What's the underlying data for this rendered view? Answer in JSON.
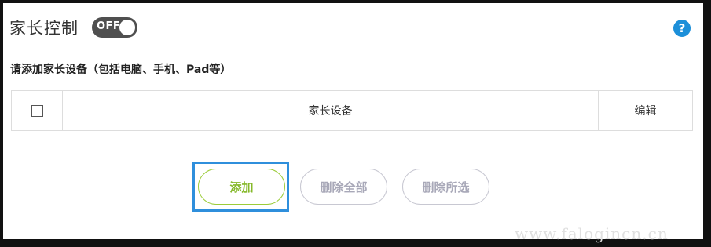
{
  "header": {
    "title": "家长控制",
    "toggle_label": "OFF",
    "help_icon": "?"
  },
  "section": {
    "subtitle": "请添加家长设备（包括电脑、手机、Pad等）"
  },
  "table": {
    "columns": [
      "",
      "家长设备",
      "编辑"
    ]
  },
  "buttons": {
    "add": "添加",
    "delete_all": "删除全部",
    "delete_selected": "删除所选"
  },
  "watermark": "www.falogincn.cn",
  "colors": {
    "toggle_bg": "#4f4f4f",
    "help_bg": "#1c8fd9",
    "add_border": "#9ccc3a",
    "highlight": "#2f8fdc",
    "disabled": "#a8a8b8"
  }
}
